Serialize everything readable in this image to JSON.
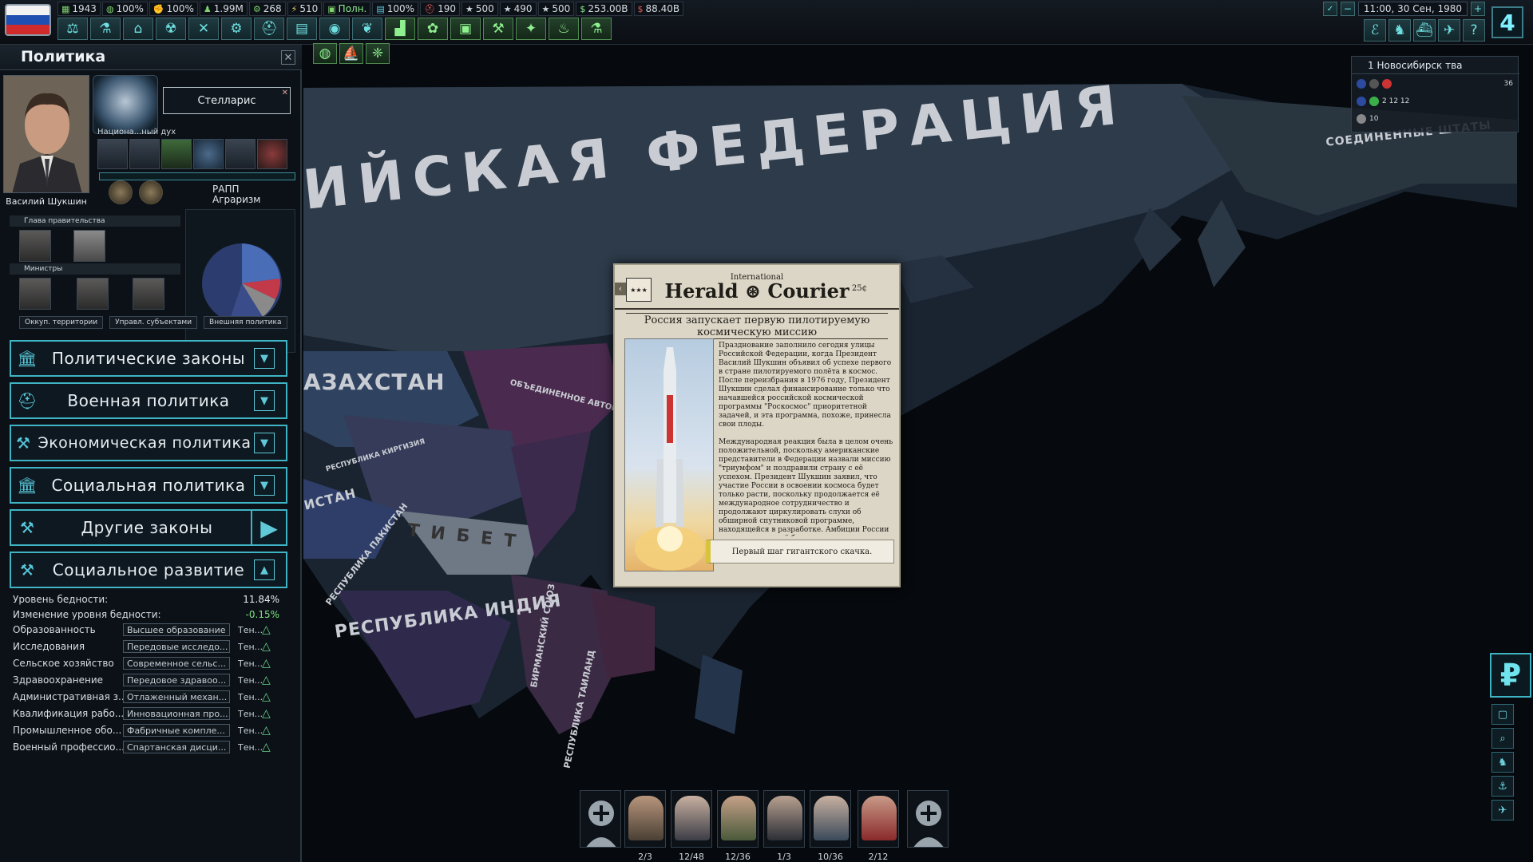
{
  "topbar": {
    "stats": [
      "1943",
      "100%",
      "100%",
      "1.99M",
      "268",
      "510",
      "Полн.",
      "100%",
      "190",
      "500",
      "490",
      "500",
      "253.00B",
      "88.40B"
    ],
    "datetime": "11:00, 30 Сен, 1980",
    "speed": "4"
  },
  "left_panel": {
    "title": "Политика",
    "leader_name": "Василий Шукшин",
    "national_focus": "Стелларис",
    "national_spirit_label": "Национа...ный дух",
    "party_name": "РАПП",
    "party_ideology": "Аграризм",
    "gov_head_label": "Глава правительства",
    "ministers_label": "Министры",
    "tabs": [
      "Оккуп. территории",
      "Управл. субъектами",
      "Внешняя политика"
    ],
    "categories": [
      {
        "label": "Политические законы",
        "icon": "bank-icon",
        "btn": "▼"
      },
      {
        "label": "Военная политика",
        "icon": "helmet-icon",
        "btn": "▼"
      },
      {
        "label": "Экономическая политика",
        "icon": "gavel-icon",
        "btn": "▼"
      },
      {
        "label": "Социальная политика",
        "icon": "bank-icon",
        "btn": "▼"
      },
      {
        "label": "Другие законы",
        "icon": "hammer-icon",
        "btn": "▶"
      },
      {
        "label": "Социальное развитие",
        "icon": "hammer-icon",
        "btn": "▲"
      }
    ],
    "poverty_label": "Уровень бедности:",
    "poverty_value": "11.84%",
    "poverty_change_label": "Изменение уровня бедности:",
    "poverty_change_value": "-0.15%",
    "social_rows": [
      {
        "k": "Образованность",
        "v": "Высшее образование",
        "t": "Тен..."
      },
      {
        "k": "Исследования",
        "v": "Передовые исследо...",
        "t": "Тен..."
      },
      {
        "k": "Сельское хозяйство",
        "v": "Современное сельс...",
        "t": "Тен..."
      },
      {
        "k": "Здравоохранение",
        "v": "Передовое здравоо...",
        "t": "Тен..."
      },
      {
        "k": "Административная з...",
        "v": "Отлаженный механ...",
        "t": "Тен..."
      },
      {
        "k": "Квалификация рабо...",
        "v": "Инновационная про...",
        "t": "Тен..."
      },
      {
        "k": "Промышленное обо...",
        "v": "Фабричные компле...",
        "t": "Тен..."
      },
      {
        "k": "Военный профессио...",
        "v": "Спартанская дисци...",
        "t": "Тен..."
      }
    ],
    "pie_colors": [
      "#3a4c8a",
      "#4a6db8",
      "#c23a4a",
      "#8a8a8a",
      "#2c3c6e"
    ]
  },
  "map": {
    "labels": [
      {
        "text": "ИЙСКАЯ ФЕДЕРАЦИЯ",
        "size": "big"
      },
      {
        "text": "АЗАХСТАН",
        "size": "mid"
      },
      {
        "text": "ТИБЕТ",
        "size": "mid"
      },
      {
        "text": "РЕСПУБЛИКА ИНДИЯ",
        "size": "mid"
      },
      {
        "text": "СОЕДИНЕННЫЕ ШТАТЫ",
        "size": "small"
      },
      {
        "text": "ОБЪЕДИНЕННОЕ АВТОНОМНОЕ ПРАВИТЕЛ...",
        "size": "tiny"
      },
      {
        "text": "РЕСПУБЛИКА КИРГИЗИЯ",
        "size": "tiny"
      },
      {
        "text": "ИСТАН",
        "size": "small"
      },
      {
        "text": "РЕСПУБЛИКА ПАКИСТАН",
        "size": "tiny"
      },
      {
        "text": "БИРМАНСКИЙ СОЮЗ",
        "size": "tiny"
      },
      {
        "text": "РЕСПУБЛИКА ТАИЛАНД",
        "size": "tiny"
      }
    ]
  },
  "newspaper": {
    "international": "International",
    "title": "Herald ⊛ Courier",
    "price": "25¢",
    "badge": "★★★",
    "headline": "Россия запускает первую пилотируемую космическую миссию",
    "body": "Празднование заполнило сегодня улицы Российской Федерации, когда Президент Василий Шукшин объявил об успехе первого в стране пилотируемого полёта в космос. После переизбрания в 1976 году, Президент Шукшин сделал финансирование только что начавшейся российской космической программы \"Роскосмос\" приоритетной задачей, и эта программа, похоже, принесла свои плоды.\n\nМеждународная реакция была в целом очень положительной, поскольку американские представители в Федерации назвали миссию \"триумфом\" и поздравили страну с её успехом. Президент Шукшин заявил, что участие России в освоении космоса будет только расти, поскольку продолжается её международное сотрудничество и продолжают циркулировать слухи об обширной спутниковой программе, находящейся в разработке. Амбиции России устремлены к ещё большим высотам по мере того, как четвёртая держава занимает своё место среди звёзд.",
    "button": "Первый шаг гигантского скачка."
  },
  "right_panel": {
    "title": "1 Новосибирск тва",
    "count": "36",
    "line2": "2 12 12",
    "line3": "10"
  },
  "currency_symbol": "₽",
  "generals": {
    "counts": [
      "2/3",
      "12/48",
      "12/36",
      "1/3",
      "10/36",
      "2/12"
    ]
  }
}
